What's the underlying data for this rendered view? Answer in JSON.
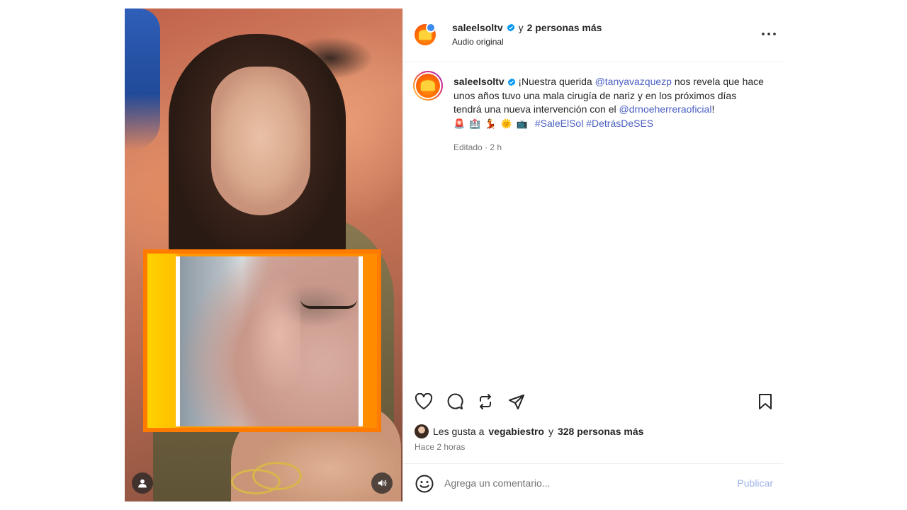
{
  "post": {
    "account": "saleelsoltv",
    "coauthors_text": "y 2 personas más",
    "coauthors_prefix": "y",
    "coauthors_suffix": "2 personas más",
    "audio": "Audio original",
    "caption": {
      "username": "saleelsoltv",
      "text_1": "¡Nuestra querida",
      "mention_1": "@tanyavazquezp",
      "text_2": "nos revela que hace unos años tuvo una mala cirugía de nariz y en los próximos días tendrá una nueva intervención con el",
      "mention_2": "@drnoeherreraoficial",
      "text_3": "!",
      "emojis": [
        "🚨",
        "🏥",
        "💃",
        "🌞",
        "📺"
      ],
      "hashtag_1": "#SaleElSol",
      "hashtag_2": "#DetrásDeSES",
      "meta": "Editado · 2 h"
    },
    "likes": {
      "prefix": "Les gusta a",
      "user": "vegabiestro",
      "middle": "y",
      "others": "328 personas más"
    },
    "time_ago": "Hace 2 horas"
  },
  "comment": {
    "placeholder": "Agrega un comentario...",
    "publish_label": "Publicar"
  },
  "icons": {
    "like": "heart-icon",
    "comment": "comment-icon",
    "share_repost": "repost-icon",
    "send": "send-icon",
    "save": "bookmark-icon",
    "more": "more-options-icon",
    "emoji": "emoji-icon",
    "sound": "volume-icon",
    "tagged_user": "user-icon",
    "verified": "verified-badge-icon"
  },
  "colors": {
    "link": "#4a5fc1",
    "verified": "#0095f6",
    "publish_disabled": "#9fb4e8",
    "secondary_text": "#737373"
  }
}
